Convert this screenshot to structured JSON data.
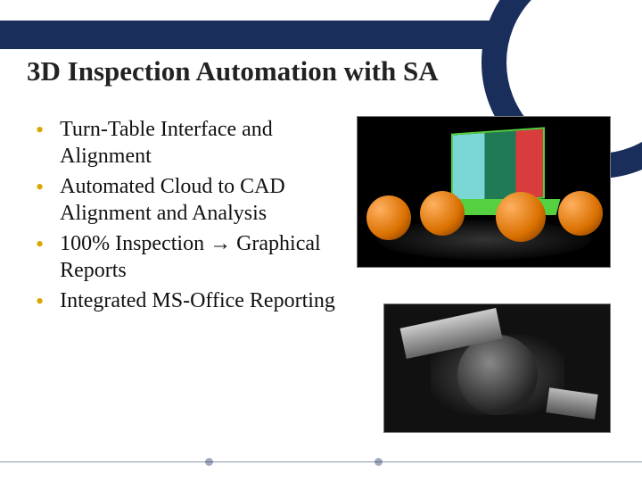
{
  "title": "3D Inspection Automation with SA",
  "bullets": [
    "Turn-Table Interface and Alignment",
    "Automated Cloud to CAD Alignment and Analysis",
    "100% Inspection → Graphical Reports",
    "Integrated MS-Office Reporting"
  ],
  "images": {
    "top_alt": "Point-cloud spheres and colored CAD box on a turntable",
    "bottom_alt": "Rotary fixture with scanning hardware"
  }
}
